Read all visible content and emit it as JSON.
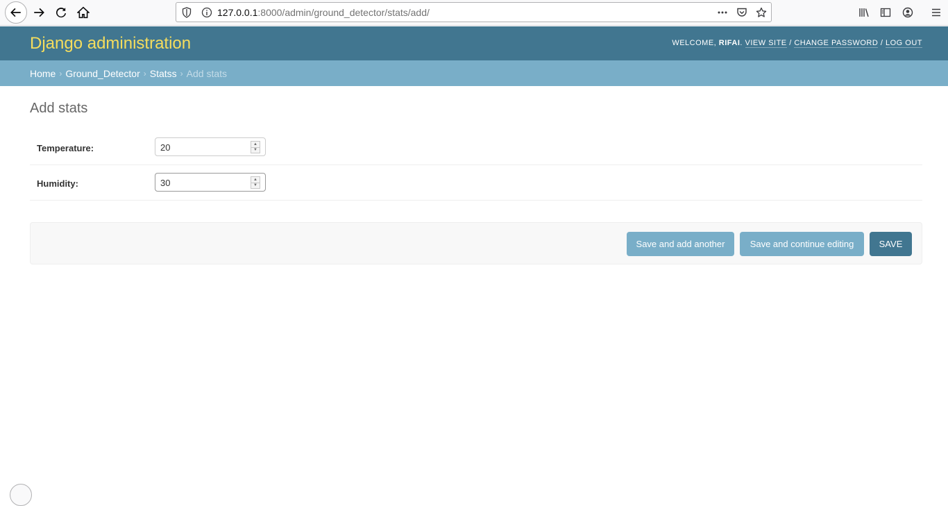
{
  "browser": {
    "url_host": "127.0.0.1",
    "url_rest": ":8000/admin/ground_detector/stats/add/"
  },
  "header": {
    "site_title": "Django administration",
    "welcome_prefix": "Welcome, ",
    "username": "rifai",
    "welcome_suffix": ". ",
    "view_site": "View site",
    "sep1": " / ",
    "change_password": "Change password",
    "sep2": " / ",
    "log_out": "Log out"
  },
  "breadcrumbs": {
    "home": "Home",
    "app": "Ground_Detector",
    "model": "Statss",
    "current": "Add stats",
    "separator": "›"
  },
  "page": {
    "title": "Add stats"
  },
  "form": {
    "temperature": {
      "label": "Temperature:",
      "value": "20"
    },
    "humidity": {
      "label": "Humidity:",
      "value": "30"
    }
  },
  "submit": {
    "save_add_another": "Save and add another",
    "save_continue": "Save and continue editing",
    "save": "Save"
  },
  "colors": {
    "header_bg": "#417690",
    "breadcrumb_bg": "#79aec8",
    "title_yellow": "#f5dd5d"
  }
}
